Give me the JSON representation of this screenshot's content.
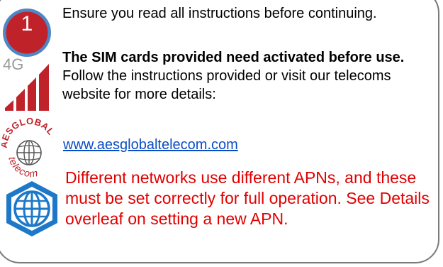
{
  "step": {
    "number": "1",
    "badge_color": "#c0222a",
    "badge_ring": "#4f86c6"
  },
  "instructions": {
    "intro": "Ensure you read all instructions before continuing.",
    "sim_bold": "The SIM cards provided need activated before use.",
    "sim_rest": " Follow the instructions provided or visit our telecoms website for more details:",
    "link_text": "www.aesglobaltelecom.com",
    "apn_warning": "Different networks use different APNs, and these must be set correctly for full operation. See Details overleaf on setting a new APN."
  },
  "icons": {
    "network_label": "4G",
    "network_icon": "4g-signal-icon",
    "logo_icon": "aes-global-telecom-logo-icon",
    "logo_text_top": "AESGLOBAL",
    "logo_text_bottom": "telecom",
    "globe_icon": "globe-network-icon"
  },
  "colors": {
    "accent_red": "#c0222a",
    "warning_red": "#e00000",
    "link_blue": "#0a4dc2",
    "globe_blue": "#1e78c8",
    "border_gray": "#7a7a7a"
  }
}
